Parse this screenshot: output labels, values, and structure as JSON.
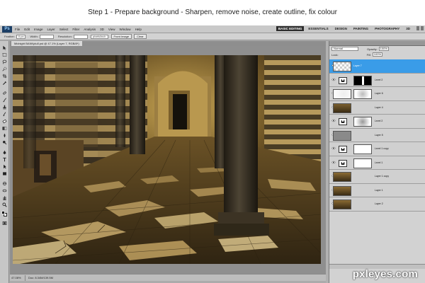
{
  "title": "Step 1 - Prepare background - Sharpen, remove noise, create outline, fix colour",
  "menubar": {
    "app_logo": "Ps",
    "items": [
      "File",
      "Edit",
      "Image",
      "Layer",
      "Select",
      "Filter",
      "Analysis",
      "3D",
      "View",
      "Window",
      "Help"
    ],
    "workspaces": [
      "BASIC EDITING",
      "ESSENTIALS",
      "DESIGN",
      "PAINTING",
      "PHOTOGRAPHY",
      "3D"
    ],
    "active_workspace": "BASIC EDITING"
  },
  "optionsbar": {
    "feather_label": "Feather:",
    "feather_value": "0 px",
    "width_label": "Width:",
    "resolution_label": "Resolution:",
    "resolution_unit": "pixels/inch",
    "front_image_button": "Front Image",
    "clear_button": "Clear"
  },
  "document": {
    "tab_title": "Midnight BANKplu8.pst @ 47.1% (Layer 7, RGB/8*)",
    "zoom": "47.08%",
    "doc_info": "Doc: 8.34M/139.5M"
  },
  "layers_panel": {
    "tabs": [
      "LAYERS"
    ],
    "blend_mode": "Normal",
    "opacity_label": "Opacity:",
    "opacity_value": "100%",
    "lock_label": "Lock:",
    "fill_label": "Fill:",
    "fill_value": "100%",
    "layers": [
      {
        "name": "Layer 7",
        "selected": true,
        "thumb": "transparent",
        "mask": null
      },
      {
        "name": "Level 2",
        "selected": false,
        "thumb": "adjustment",
        "mask": "black-white"
      },
      {
        "name": "Layer 6",
        "selected": false,
        "thumb": "light",
        "mask": "blur"
      },
      {
        "name": "Layer 4",
        "selected": false,
        "thumb": "photo",
        "mask": null
      },
      {
        "name": "Level 2",
        "selected": false,
        "thumb": "adjustment",
        "mask": "blur"
      },
      {
        "name": "Layer 5",
        "selected": false,
        "thumb": "gray",
        "mask": null
      },
      {
        "name": "Level 1 copy",
        "selected": false,
        "thumb": "adjustment",
        "mask": "white"
      },
      {
        "name": "Level 1",
        "selected": false,
        "thumb": "adjustment",
        "mask": "white"
      },
      {
        "name": "Layer 1 copy",
        "selected": false,
        "thumb": "photo",
        "mask": null
      },
      {
        "name": "Layer 1",
        "selected": false,
        "thumb": "photo",
        "mask": null
      },
      {
        "name": "Layer 2",
        "selected": false,
        "thumb": "photo",
        "mask": null
      }
    ]
  },
  "colors": {
    "selection_blue": "#3a9ce8",
    "panel_gray": "#d2d2d2",
    "canvas_gray": "#8f8f8f"
  },
  "watermark": "pxleyes.com"
}
